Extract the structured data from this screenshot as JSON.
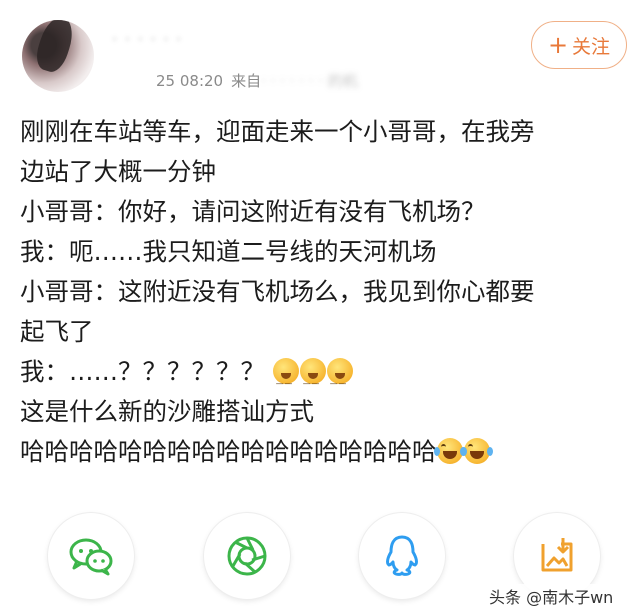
{
  "author": {
    "name": "· · ·  ·  · ·",
    "time": "25 08:20",
    "source_prefix": "来自",
    "source_hidden": "· · · · · · · 的机"
  },
  "follow_button": {
    "label": "关注",
    "plus": "+"
  },
  "post": {
    "lines": [
      "刚刚在车站等车，迎面走来一个小哥哥，在我旁",
      "边站了大概一分钟",
      "小哥哥：你好，请问这附近有没有飞机场？",
      "我：呃……我只知道二号线的天河机场",
      "小哥哥：这附近没有飞机场么，我见到你心都要",
      "起飞了",
      "我：……？？？？？？",
      "这是什么新的沙雕搭讪方式",
      "哈哈哈哈哈哈哈哈哈哈哈哈哈哈哈哈哈"
    ]
  },
  "share_icons": [
    "wechat-icon",
    "moments-icon",
    "qq-icon",
    "save-image-icon"
  ],
  "colors": {
    "follow_text": "#e8793a",
    "follow_border": "#f0b087",
    "share_green": "#3cb54a",
    "share_blue": "#2e9df0",
    "share_orange": "#f0a12e"
  },
  "watermark": "头条 @南木子wn"
}
